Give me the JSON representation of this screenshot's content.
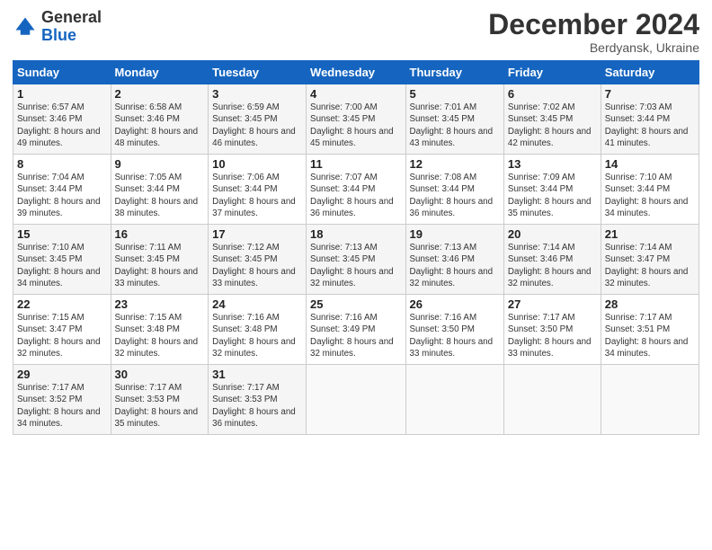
{
  "header": {
    "logo_general": "General",
    "logo_blue": "Blue",
    "title": "December 2024",
    "subtitle": "Berdyansk, Ukraine"
  },
  "columns": [
    "Sunday",
    "Monday",
    "Tuesday",
    "Wednesday",
    "Thursday",
    "Friday",
    "Saturday"
  ],
  "weeks": [
    [
      {
        "day": "1",
        "sunrise": "Sunrise: 6:57 AM",
        "sunset": "Sunset: 3:46 PM",
        "daylight": "Daylight: 8 hours and 49 minutes."
      },
      {
        "day": "2",
        "sunrise": "Sunrise: 6:58 AM",
        "sunset": "Sunset: 3:46 PM",
        "daylight": "Daylight: 8 hours and 48 minutes."
      },
      {
        "day": "3",
        "sunrise": "Sunrise: 6:59 AM",
        "sunset": "Sunset: 3:45 PM",
        "daylight": "Daylight: 8 hours and 46 minutes."
      },
      {
        "day": "4",
        "sunrise": "Sunrise: 7:00 AM",
        "sunset": "Sunset: 3:45 PM",
        "daylight": "Daylight: 8 hours and 45 minutes."
      },
      {
        "day": "5",
        "sunrise": "Sunrise: 7:01 AM",
        "sunset": "Sunset: 3:45 PM",
        "daylight": "Daylight: 8 hours and 43 minutes."
      },
      {
        "day": "6",
        "sunrise": "Sunrise: 7:02 AM",
        "sunset": "Sunset: 3:45 PM",
        "daylight": "Daylight: 8 hours and 42 minutes."
      },
      {
        "day": "7",
        "sunrise": "Sunrise: 7:03 AM",
        "sunset": "Sunset: 3:44 PM",
        "daylight": "Daylight: 8 hours and 41 minutes."
      }
    ],
    [
      {
        "day": "8",
        "sunrise": "Sunrise: 7:04 AM",
        "sunset": "Sunset: 3:44 PM",
        "daylight": "Daylight: 8 hours and 39 minutes."
      },
      {
        "day": "9",
        "sunrise": "Sunrise: 7:05 AM",
        "sunset": "Sunset: 3:44 PM",
        "daylight": "Daylight: 8 hours and 38 minutes."
      },
      {
        "day": "10",
        "sunrise": "Sunrise: 7:06 AM",
        "sunset": "Sunset: 3:44 PM",
        "daylight": "Daylight: 8 hours and 37 minutes."
      },
      {
        "day": "11",
        "sunrise": "Sunrise: 7:07 AM",
        "sunset": "Sunset: 3:44 PM",
        "daylight": "Daylight: 8 hours and 36 minutes."
      },
      {
        "day": "12",
        "sunrise": "Sunrise: 7:08 AM",
        "sunset": "Sunset: 3:44 PM",
        "daylight": "Daylight: 8 hours and 36 minutes."
      },
      {
        "day": "13",
        "sunrise": "Sunrise: 7:09 AM",
        "sunset": "Sunset: 3:44 PM",
        "daylight": "Daylight: 8 hours and 35 minutes."
      },
      {
        "day": "14",
        "sunrise": "Sunrise: 7:10 AM",
        "sunset": "Sunset: 3:44 PM",
        "daylight": "Daylight: 8 hours and 34 minutes."
      }
    ],
    [
      {
        "day": "15",
        "sunrise": "Sunrise: 7:10 AM",
        "sunset": "Sunset: 3:45 PM",
        "daylight": "Daylight: 8 hours and 34 minutes."
      },
      {
        "day": "16",
        "sunrise": "Sunrise: 7:11 AM",
        "sunset": "Sunset: 3:45 PM",
        "daylight": "Daylight: 8 hours and 33 minutes."
      },
      {
        "day": "17",
        "sunrise": "Sunrise: 7:12 AM",
        "sunset": "Sunset: 3:45 PM",
        "daylight": "Daylight: 8 hours and 33 minutes."
      },
      {
        "day": "18",
        "sunrise": "Sunrise: 7:13 AM",
        "sunset": "Sunset: 3:45 PM",
        "daylight": "Daylight: 8 hours and 32 minutes."
      },
      {
        "day": "19",
        "sunrise": "Sunrise: 7:13 AM",
        "sunset": "Sunset: 3:46 PM",
        "daylight": "Daylight: 8 hours and 32 minutes."
      },
      {
        "day": "20",
        "sunrise": "Sunrise: 7:14 AM",
        "sunset": "Sunset: 3:46 PM",
        "daylight": "Daylight: 8 hours and 32 minutes."
      },
      {
        "day": "21",
        "sunrise": "Sunrise: 7:14 AM",
        "sunset": "Sunset: 3:47 PM",
        "daylight": "Daylight: 8 hours and 32 minutes."
      }
    ],
    [
      {
        "day": "22",
        "sunrise": "Sunrise: 7:15 AM",
        "sunset": "Sunset: 3:47 PM",
        "daylight": "Daylight: 8 hours and 32 minutes."
      },
      {
        "day": "23",
        "sunrise": "Sunrise: 7:15 AM",
        "sunset": "Sunset: 3:48 PM",
        "daylight": "Daylight: 8 hours and 32 minutes."
      },
      {
        "day": "24",
        "sunrise": "Sunrise: 7:16 AM",
        "sunset": "Sunset: 3:48 PM",
        "daylight": "Daylight: 8 hours and 32 minutes."
      },
      {
        "day": "25",
        "sunrise": "Sunrise: 7:16 AM",
        "sunset": "Sunset: 3:49 PM",
        "daylight": "Daylight: 8 hours and 32 minutes."
      },
      {
        "day": "26",
        "sunrise": "Sunrise: 7:16 AM",
        "sunset": "Sunset: 3:50 PM",
        "daylight": "Daylight: 8 hours and 33 minutes."
      },
      {
        "day": "27",
        "sunrise": "Sunrise: 7:17 AM",
        "sunset": "Sunset: 3:50 PM",
        "daylight": "Daylight: 8 hours and 33 minutes."
      },
      {
        "day": "28",
        "sunrise": "Sunrise: 7:17 AM",
        "sunset": "Sunset: 3:51 PM",
        "daylight": "Daylight: 8 hours and 34 minutes."
      }
    ],
    [
      {
        "day": "29",
        "sunrise": "Sunrise: 7:17 AM",
        "sunset": "Sunset: 3:52 PM",
        "daylight": "Daylight: 8 hours and 34 minutes."
      },
      {
        "day": "30",
        "sunrise": "Sunrise: 7:17 AM",
        "sunset": "Sunset: 3:53 PM",
        "daylight": "Daylight: 8 hours and 35 minutes."
      },
      {
        "day": "31",
        "sunrise": "Sunrise: 7:17 AM",
        "sunset": "Sunset: 3:53 PM",
        "daylight": "Daylight: 8 hours and 36 minutes."
      },
      null,
      null,
      null,
      null
    ]
  ]
}
